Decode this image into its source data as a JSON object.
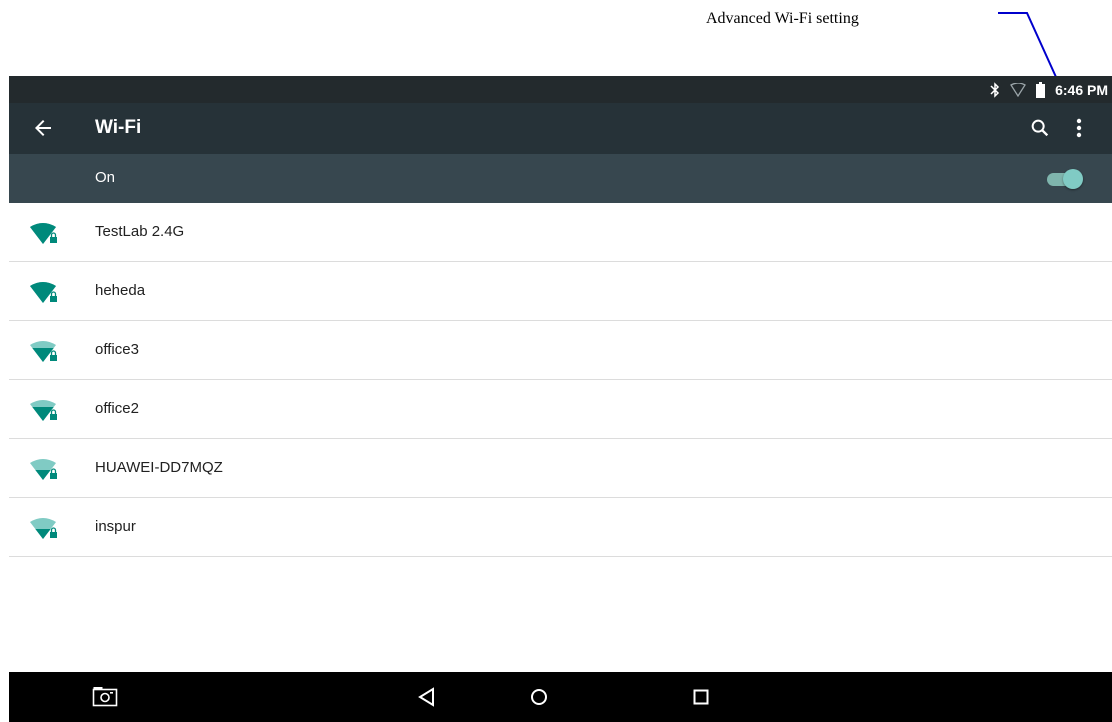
{
  "annotation": {
    "label": "Advanced Wi-Fi setting"
  },
  "status_bar": {
    "time": "6:46 PM",
    "icons": [
      "bluetooth-icon",
      "wifi-signal-icon",
      "battery-icon"
    ]
  },
  "app_bar": {
    "title": "Wi-Fi",
    "actions": [
      "search-icon",
      "more-vert-icon"
    ]
  },
  "switch_bar": {
    "label": "On",
    "enabled": true
  },
  "networks": [
    {
      "ssid": "TestLab 2.4G",
      "signal": "full",
      "secured": true
    },
    {
      "ssid": "heheda",
      "signal": "full",
      "secured": true
    },
    {
      "ssid": "office3",
      "signal": "medium",
      "secured": true
    },
    {
      "ssid": "office2",
      "signal": "medium",
      "secured": true
    },
    {
      "ssid": "HUAWEI-DD7MQZ",
      "signal": "low",
      "secured": true
    },
    {
      "ssid": "inspur",
      "signal": "low",
      "secured": true
    }
  ],
  "nav_bar": {
    "buttons": [
      "screenshot-icon",
      "back-icon",
      "home-icon",
      "recents-icon"
    ]
  },
  "colors": {
    "accent": "#00897b",
    "accent_light": "#80cbc4",
    "app_bar": "#263238",
    "switch_bar": "#37474f",
    "status_bar": "#232a2d"
  }
}
